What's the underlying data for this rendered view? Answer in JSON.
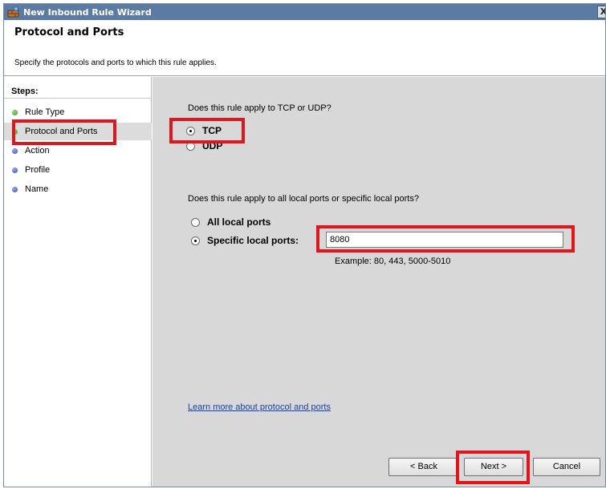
{
  "window": {
    "title": "New Inbound Rule Wizard",
    "close_glyph": "X"
  },
  "header": {
    "title": "Protocol and Ports",
    "subtitle": "Specify the protocols and ports to which this rule applies."
  },
  "steps": {
    "title": "Steps:",
    "items": [
      {
        "label": "Rule Type",
        "status": "done"
      },
      {
        "label": "Protocol and Ports",
        "status": "current"
      },
      {
        "label": "Action",
        "status": "pending"
      },
      {
        "label": "Profile",
        "status": "pending"
      },
      {
        "label": "Name",
        "status": "pending"
      }
    ]
  },
  "protocol": {
    "question": "Does this rule apply to TCP or UDP?",
    "tcp_label": "TCP",
    "udp_label": "UDP",
    "selected": "TCP"
  },
  "ports": {
    "question": "Does this rule apply to all local ports or specific local ports?",
    "all_label": "All local ports",
    "specific_label": "Specific local ports:",
    "selected": "specific",
    "value": "8080",
    "example": "Example: 80, 443, 5000-5010"
  },
  "learn_more": "Learn more about protocol and ports",
  "buttons": {
    "back": "< Back",
    "next": "Next >",
    "cancel": "Cancel"
  },
  "colors": {
    "title_bar": "#5b7ba4",
    "highlight": "#e0161f",
    "link": "#1a3ea8",
    "content_bg": "#d8d8d8"
  }
}
